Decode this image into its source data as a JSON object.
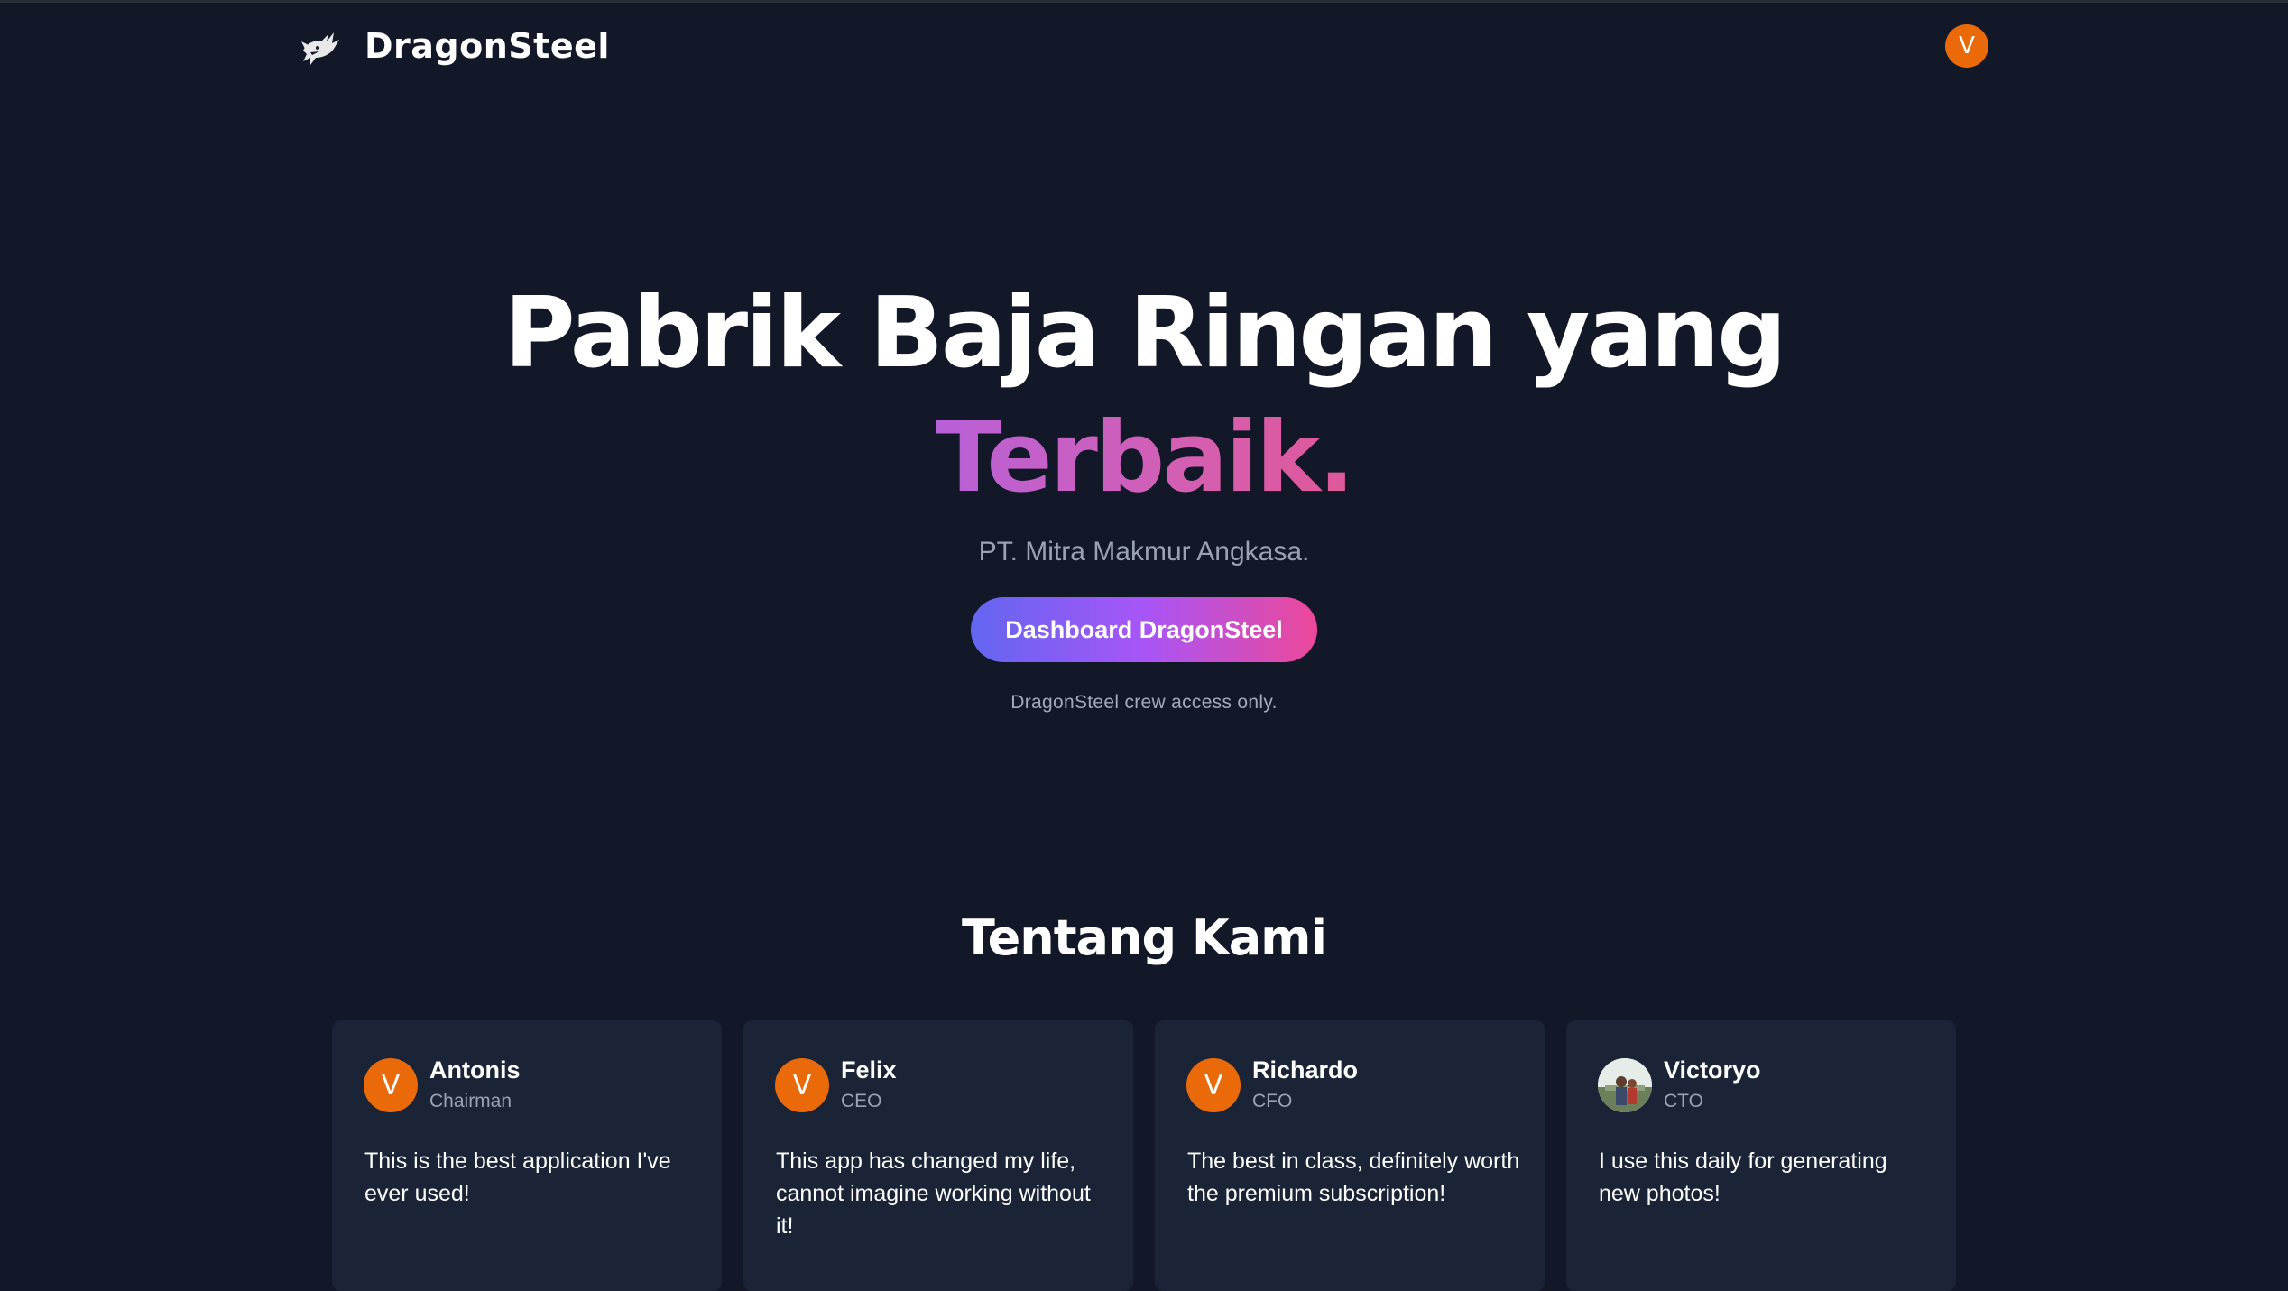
{
  "header": {
    "brand": "DragonSteel",
    "logo_icon": "dragon-icon",
    "avatar_initial": "V"
  },
  "hero": {
    "title_line1": "Pabrik Baja Ringan yang",
    "title_accent": "Terbaik.",
    "subtitle": "PT. Mitra Makmur Angkasa.",
    "cta_label": "Dashboard DragonSteel",
    "note": "DragonSteel crew access only."
  },
  "about": {
    "title": "Tentang Kami",
    "cards": [
      {
        "avatar": "V",
        "name": "Antonis",
        "role": "Chairman",
        "text": "This is the best application I've ever used!"
      },
      {
        "avatar": "V",
        "name": "Felix",
        "role": "CEO",
        "text": "This app has changed my life, cannot imagine working without it!"
      },
      {
        "avatar": "V",
        "name": "Richardo",
        "role": "CFO",
        "text": "The best in class, definitely worth the premium subscription!"
      },
      {
        "avatar": "photo",
        "name": "Victoryo",
        "role": "CTO",
        "text": "I use this daily for generating new photos!"
      }
    ]
  },
  "colors": {
    "background": "#121827",
    "card": "#1b2436",
    "avatar_orange": "#ea6a0a",
    "accent_gradient_start": "#6366f1",
    "accent_gradient_end": "#ec4899"
  }
}
